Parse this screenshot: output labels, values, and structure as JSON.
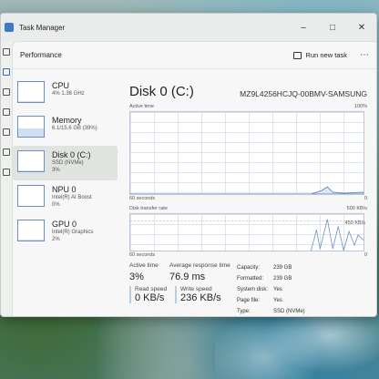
{
  "window": {
    "title": "Task Manager"
  },
  "header": {
    "title": "Performance",
    "run_task_label": "Run new task"
  },
  "perf_items": [
    {
      "name": "CPU",
      "sub1": "4% 1.36 GHz",
      "sub2": "",
      "fill": 0.04
    },
    {
      "name": "Memory",
      "sub1": "6.1/15.6 GB (39%)",
      "sub2": "",
      "fill": 0.39
    },
    {
      "name": "Disk 0 (C:)",
      "sub1": "SSD (NVMe)",
      "sub2": "3%",
      "fill": 0.03
    },
    {
      "name": "NPU 0",
      "sub1": "Intel(R) AI Boost",
      "sub2": "0%",
      "fill": 0.0
    },
    {
      "name": "GPU 0",
      "sub1": "Intel(R) Graphics",
      "sub2": "2%",
      "fill": 0.02
    }
  ],
  "detail": {
    "title": "Disk 0 (C:)",
    "model": "MZ9L4256HCJQ-00BMV-SAMSUNG",
    "active_time_label": "Active time",
    "active_time_max": "100%",
    "graph1_x_label": "60 seconds",
    "graph1_zero": "0",
    "transfer_label": "Disk transfer rate",
    "transfer_max": "500 KB/s",
    "transfer_marker": "450 KB/s",
    "graph2_x_label": "60 seconds",
    "graph2_zero": "0"
  },
  "stats": {
    "active_time_label": "Active time",
    "active_time_value": "3%",
    "response_label": "Average response time",
    "response_value": "76.9 ms",
    "read_label": "Read speed",
    "read_value": "0 KB/s",
    "write_label": "Write speed",
    "write_value": "236 KB/s",
    "info": [
      {
        "key": "Capacity:",
        "value": "239 GB"
      },
      {
        "key": "Formatted:",
        "value": "239 GB"
      },
      {
        "key": "System disk:",
        "value": "Yes"
      },
      {
        "key": "Page file:",
        "value": "Yes"
      },
      {
        "key": "Type:",
        "value": "SSD (NVMe)"
      }
    ]
  },
  "colors": {
    "accent": "#2f6cc2",
    "graph_line": "#6b8fc4",
    "graph_fill": "#cfe0f2"
  }
}
